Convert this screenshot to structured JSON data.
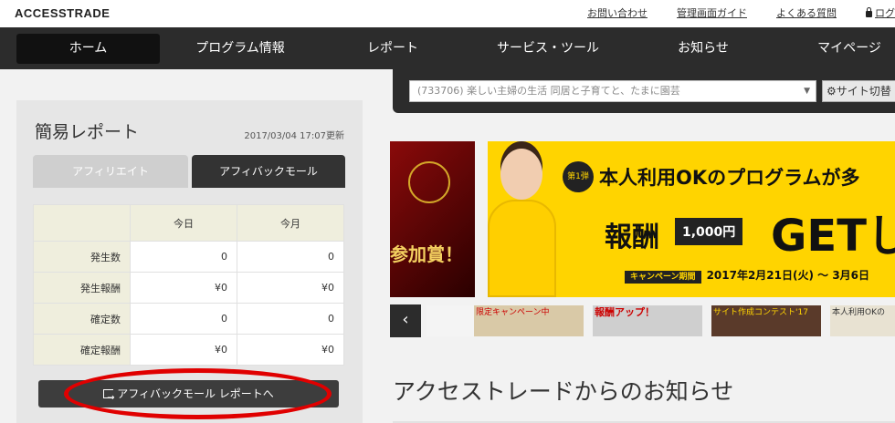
{
  "header": {
    "logo": "ACCESSTRADE",
    "links": [
      "お問い合わせ",
      "管理画面ガイド",
      "よくある質問",
      "ログ"
    ]
  },
  "nav": {
    "items": [
      "ホーム",
      "プログラム情報",
      "レポート",
      "サービス・ツール",
      "お知らせ",
      "マイページ"
    ],
    "active": "ホーム"
  },
  "site_selector": {
    "value": "(733706) 楽しい主婦の生活 同居と子育てと、たまに園芸",
    "button_label": "サイト切替"
  },
  "report": {
    "title": "簡易レポート",
    "updated": "2017/03/04 17:07更新",
    "tabs": [
      "アフィリエイト",
      "アフィバックモール"
    ],
    "active_tab": "アフィバックモール",
    "columns": [
      "",
      "今日",
      "今月"
    ],
    "rows": [
      {
        "label": "発生数",
        "today": "0",
        "month": "0"
      },
      {
        "label": "発生報酬",
        "today": "¥0",
        "month": "¥0"
      },
      {
        "label": "確定数",
        "today": "0",
        "month": "0"
      },
      {
        "label": "確定報酬",
        "today": "¥0",
        "month": "¥0"
      }
    ],
    "button_label": "アフィバックモール レポートへ"
  },
  "banner": {
    "left_text": "参加賞！",
    "badge": "第1弾",
    "headline": "本人利用OKのプログラムが多",
    "reward_label": "報酬",
    "amount": "1,000円",
    "get": "GETし",
    "period_tag": "キャンペーン期間",
    "period": "2017年2月21日(火) ～ 3月6日"
  },
  "thumbnails": [
    {
      "text": "",
      "color": "#f4f4f4"
    },
    {
      "text": "限定キャンペーン中",
      "color": "#d9c9a7"
    },
    {
      "text": "報酬アップ！",
      "color": "#cfcfcf"
    },
    {
      "text": "サイト作成コンテスト'17",
      "color": "#5a3a2a"
    },
    {
      "text": "本人利用OKの",
      "color": "#e8e2d2"
    }
  ],
  "news": {
    "title": "アクセストレードからのお知らせ"
  },
  "colors": {
    "nav_bg": "#2c2c2c",
    "accent_yellow": "#ffd400",
    "highlight_red": "#e00000"
  }
}
